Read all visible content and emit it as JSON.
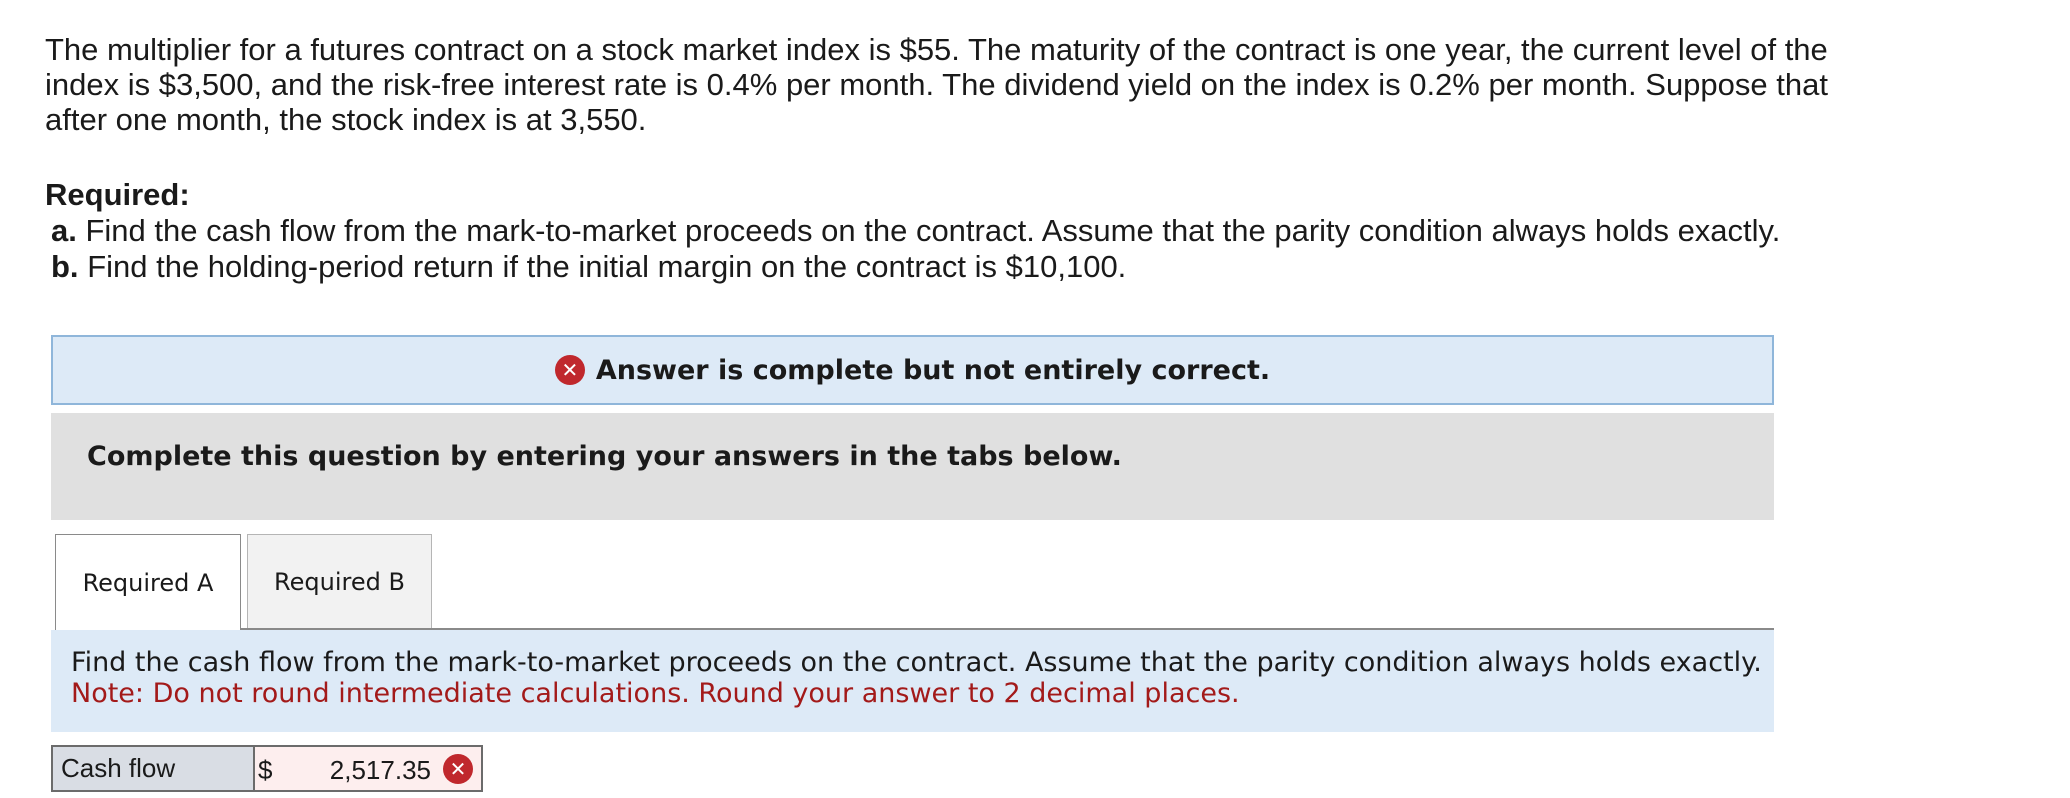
{
  "problem": {
    "text": "The multiplier for a futures contract on a stock market index is $55. The maturity of the contract is one year, the current level of the index is $3,500, and the risk-free interest rate is 0.4% per month. The dividend yield on the index is 0.2% per month. Suppose that after one month, the stock index is at 3,550."
  },
  "required": {
    "heading": "Required:",
    "items": [
      {
        "letter": "a.",
        "text": "Find the cash flow from the mark-to-market proceeds on the contract. Assume that the parity condition always holds exactly."
      },
      {
        "letter": "b.",
        "text": "Find the holding-period return if the initial margin on the contract is $10,100."
      }
    ]
  },
  "banner": {
    "icon": "x-circle-icon",
    "icon_glyph": "✕",
    "text": "Answer is complete but not entirely correct.",
    "colors": {
      "background": "#ddeaf7",
      "border": "#8fb6da",
      "icon": "#c0282d"
    }
  },
  "instructions_box": {
    "text": "Complete this question by entering your answers in the tabs below."
  },
  "tabs": [
    {
      "label": "Required A",
      "active": true
    },
    {
      "label": "Required B",
      "active": false
    }
  ],
  "tab_content": {
    "prompt": "Find the cash flow from the mark-to-market proceeds on the contract. Assume that the parity condition always holds exactly.",
    "note": "Note: Do not round intermediate calculations. Round your answer to 2 decimal places.",
    "note_color": "#a31a1a"
  },
  "answer": {
    "label": "Cash flow",
    "currency": "$",
    "value": "2,517.35",
    "status_icon": "x-circle-icon",
    "status_glyph": "✕",
    "status": "incorrect"
  }
}
